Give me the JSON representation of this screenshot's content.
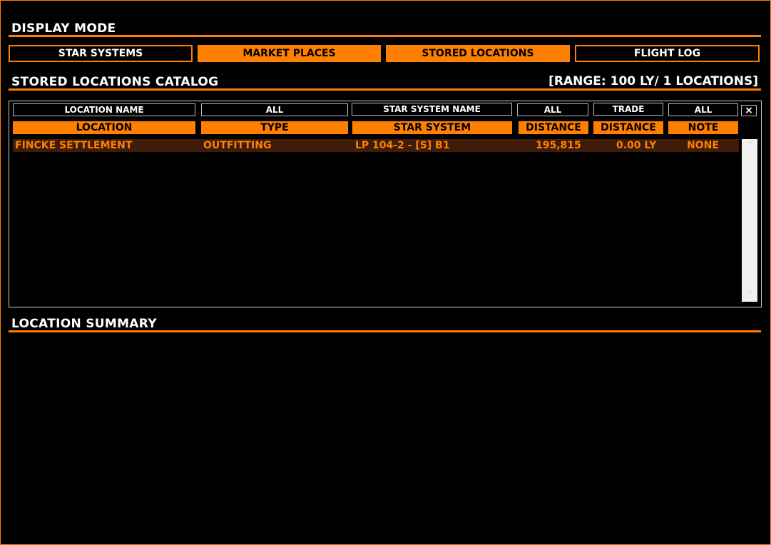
{
  "display_mode": {
    "title": "DISPLAY MODE",
    "buttons": [
      "STAR SYSTEMS",
      "MARKET PLACES",
      "STORED LOCATIONS",
      "FLIGHT LOG"
    ]
  },
  "catalog": {
    "title": "STORED LOCATIONS CATALOG",
    "range_text": "[RANGE: 100 LY/ 1 LOCATIONS]",
    "filters": [
      "LOCATION NAME",
      "ALL",
      "STAR SYSTEM NAME",
      "ALL",
      "TRADE",
      "ALL"
    ],
    "clear_label": "×",
    "columns": [
      "LOCATION",
      "TYPE",
      "STAR SYSTEM",
      "DISTANCE",
      "DISTANCE",
      "NOTE"
    ],
    "rows": [
      {
        "location": "FINCKE SETTLEMENT",
        "type": "OUTFITTING",
        "star_system": "LP 104-2 - [S] B1",
        "distance_ls": "195,815",
        "distance_ly": "0.00 LY",
        "note": "NONE"
      }
    ],
    "scroll_up": "˄",
    "scroll_down": "˅"
  },
  "summary": {
    "title": "LOCATION SUMMARY"
  },
  "colors": {
    "accent": "#ff7f00",
    "row_highlight": "#3f1c0a",
    "background": "#000000"
  }
}
